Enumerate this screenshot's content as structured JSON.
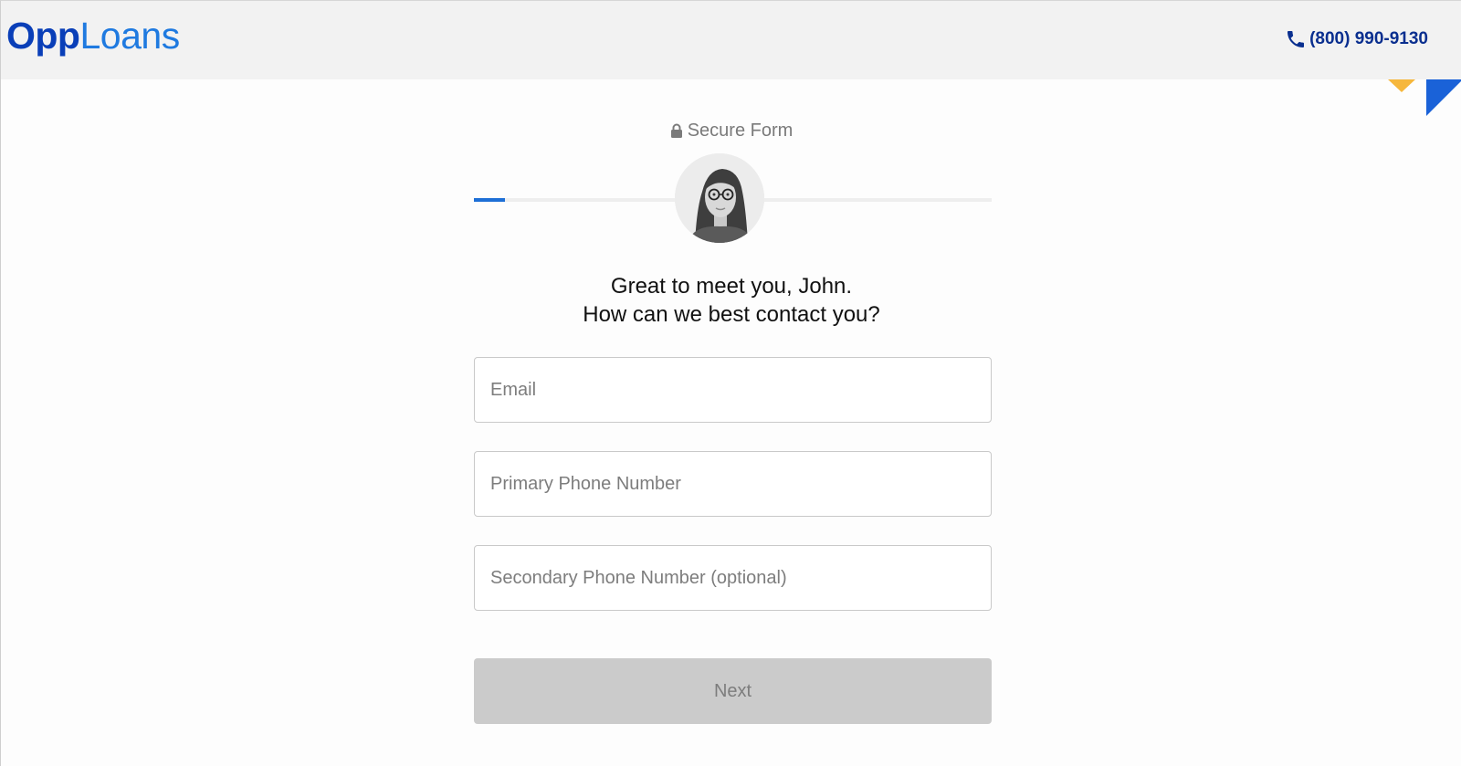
{
  "header": {
    "logo_opp": "Opp",
    "logo_loans": "Loans",
    "phone": "(800) 990-9130",
    "phone_icon": "phone-icon"
  },
  "form": {
    "secure_label": "Secure Form",
    "lock_icon": "lock-icon",
    "progress_percent": 6,
    "greeting_line1": "Great to meet you, John.",
    "greeting_line2": "How can we best contact you?",
    "email_placeholder": "Email",
    "email_value": "",
    "primary_phone_placeholder": "Primary Phone Number",
    "primary_phone_value": "",
    "secondary_phone_placeholder": "Secondary Phone Number (optional)",
    "secondary_phone_value": "",
    "next_label": "Next"
  },
  "colors": {
    "brand_dark": "#0a3fb8",
    "brand_light": "#1f7ae0",
    "progress": "#1d6fd6",
    "accent_yellow": "#f6b73c",
    "button_disabled": "#cbcbcb"
  }
}
